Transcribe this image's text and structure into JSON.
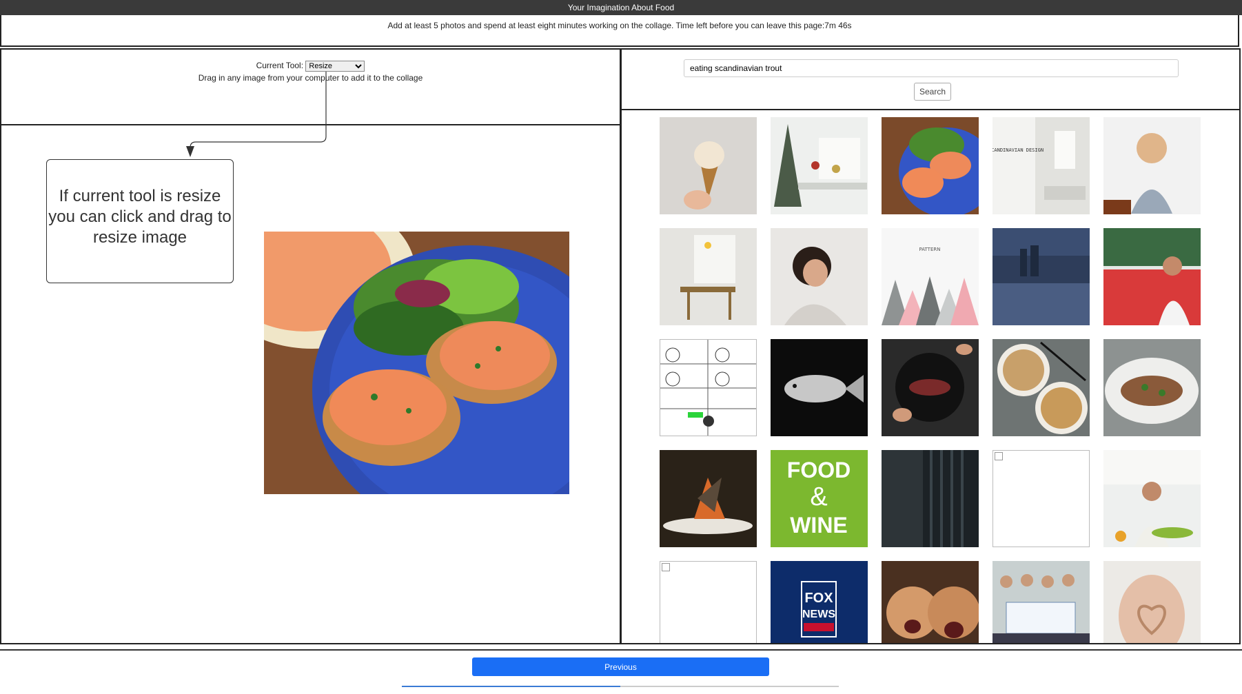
{
  "window": {
    "title": "Your Imagination About Food"
  },
  "instructions": "Add at least 5 photos and spend at least eight minutes working on the collage. Time left before you can leave this page:7m 46s",
  "toolbar": {
    "tool_label": "Current Tool:",
    "tool_value": "Resize",
    "drag_hint": "Drag in any image from your computer to add it to the collage"
  },
  "callout": {
    "text": "If current tool is resize you can click and drag to resize image"
  },
  "search": {
    "query": "eating scandinavian trout",
    "button_label": "Search"
  },
  "results": [
    {
      "id": "ice-cream-cone"
    },
    {
      "id": "winter-table"
    },
    {
      "id": "salmon-plate"
    },
    {
      "id": "scandinavian-design-cover",
      "text": "SCANDINAVIAN DESIGN"
    },
    {
      "id": "woman-thinking"
    },
    {
      "id": "kitchen-interior"
    },
    {
      "id": "sad-woman"
    },
    {
      "id": "pattern-triangles",
      "text": "PATTERN"
    },
    {
      "id": "city-harbor"
    },
    {
      "id": "woman-cafe"
    },
    {
      "id": "comic-strip"
    },
    {
      "id": "trout-fish"
    },
    {
      "id": "pan-cooking"
    },
    {
      "id": "noodle-bowls"
    },
    {
      "id": "fish-dish"
    },
    {
      "id": "plated-dish"
    },
    {
      "id": "food-and-wine-logo",
      "text": "FOOD & WINE"
    },
    {
      "id": "dark-room"
    },
    {
      "id": "broken-image"
    },
    {
      "id": "chef-kitchen"
    },
    {
      "id": "broken-image"
    },
    {
      "id": "fox-news-logo",
      "text": "FOX NEWS channel"
    },
    {
      "id": "funny-faces"
    },
    {
      "id": "group-check"
    },
    {
      "id": "heart-hands"
    }
  ],
  "footer": {
    "previous_label": "Previous",
    "progress": 0.5
  },
  "colors": {
    "accent": "#1a6ef5",
    "titlebar": "#3a3a3a"
  }
}
